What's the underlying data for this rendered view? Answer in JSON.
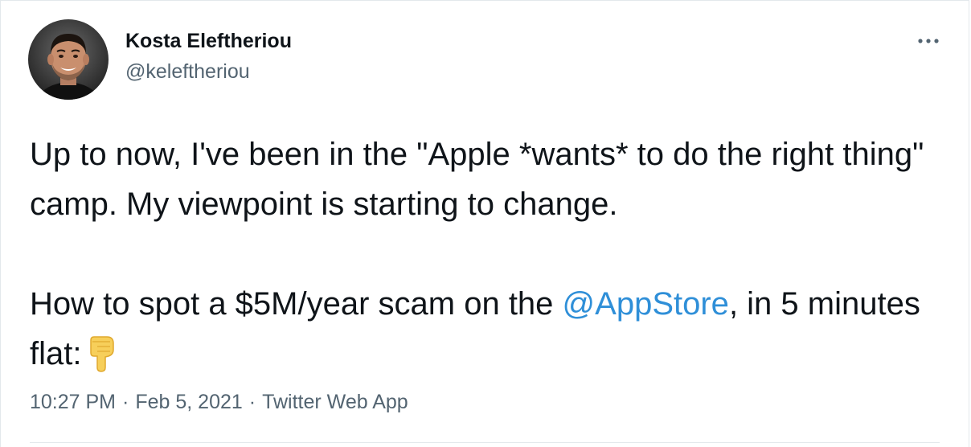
{
  "author": {
    "name": "Kosta Eleftheriou",
    "handle": "@keleftheriou",
    "avatar": "profile-photo"
  },
  "tweet": {
    "line1": "Up to now, I've been in the \"Apple *wants* to do the right thing\" camp. My viewpoint is starting to change.",
    "line2_before": "How to spot a $5M/year scam on the ",
    "mention": "@AppStore",
    "line2_after": ", in 5 minutes flat:",
    "emoji": "backhand-index-pointing-down-icon"
  },
  "meta": {
    "time": "10:27 PM",
    "separator": "·",
    "date": "Feb 5, 2021",
    "source": "Twitter Web App"
  },
  "icons": {
    "more": "more-options-icon"
  },
  "colors": {
    "text": "#0f1419",
    "secondary": "#536471",
    "link": "#2f8fd8",
    "border": "#e3e8ec"
  }
}
